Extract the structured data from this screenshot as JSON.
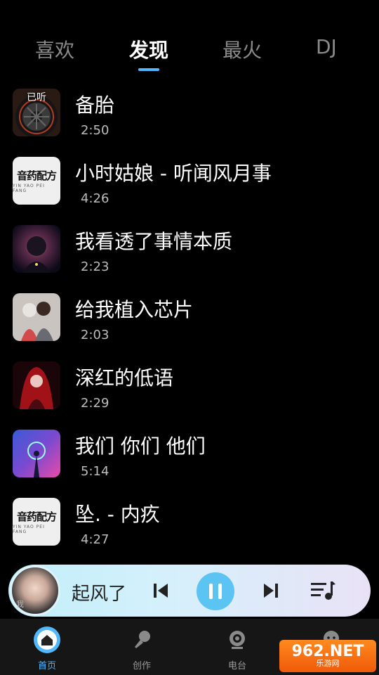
{
  "tabs": [
    {
      "label": "喜欢",
      "active": false
    },
    {
      "label": "发现",
      "active": true
    },
    {
      "label": "最火",
      "active": false
    },
    {
      "label": "DJ",
      "active": false
    }
  ],
  "songs": [
    {
      "title": "备胎",
      "duration": "2:50",
      "badge": "已听",
      "cover": "tire"
    },
    {
      "title": "小时姑娘 - 听闻风月事",
      "duration": "4:26",
      "cover": "logo"
    },
    {
      "title": "我看透了事情本质",
      "duration": "2:23",
      "cover": "dark-art"
    },
    {
      "title": "给我植入芯片",
      "duration": "2:03",
      "cover": "anime-pair"
    },
    {
      "title": "深红的低语",
      "duration": "2:29",
      "cover": "red-hair"
    },
    {
      "title": "我们 你们 他们",
      "duration": "5:14",
      "cover": "neon"
    },
    {
      "title": "坠. - 内疚",
      "duration": "4:27",
      "cover": "logo"
    }
  ],
  "cover_logo": {
    "main": "音药配方",
    "sub": "YIN YAO PEI FANG"
  },
  "player": {
    "title": "起风了",
    "avatar_caption": "我"
  },
  "bottom_nav": [
    {
      "label": "首页",
      "icon": "home-icon",
      "active": true
    },
    {
      "label": "创作",
      "icon": "microphone-icon",
      "active": false
    },
    {
      "label": "电台",
      "icon": "radio-icon",
      "active": false
    },
    {
      "label": "",
      "icon": "profile-icon",
      "active": false
    }
  ],
  "watermark": {
    "main": "962.NET",
    "sub": "乐游网"
  },
  "colors": {
    "accent": "#4fb8ff",
    "background": "#000000",
    "player_pause": "#5cc4f2",
    "watermark": "#f26a10"
  }
}
